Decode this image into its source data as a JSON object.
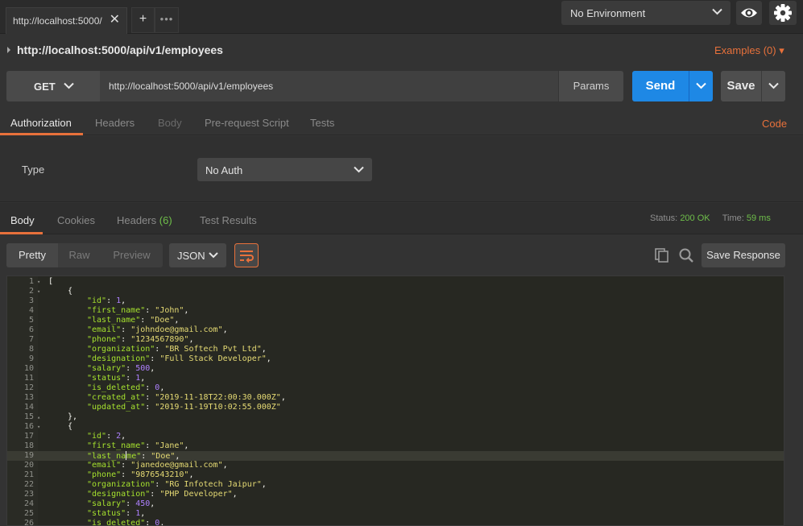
{
  "tab": {
    "title": "http://localhost:5000/",
    "close_glyph": "✕"
  },
  "new_tab_glyph": "+",
  "more_tabs_glyph": "•••",
  "environment": {
    "selected": "No Environment"
  },
  "request": {
    "title": "http://localhost:5000/api/v1/employees",
    "examples_label": "Examples (0)",
    "method": "GET",
    "url": "http://localhost:5000/api/v1/employees",
    "params_label": "Params",
    "send_label": "Send",
    "save_label": "Save"
  },
  "request_tabs": {
    "authorization": "Authorization",
    "headers": "Headers",
    "body": "Body",
    "pre_request": "Pre-request Script",
    "tests": "Tests",
    "code": "Code"
  },
  "auth": {
    "type_label": "Type",
    "selected": "No Auth"
  },
  "response_tabs": {
    "body": "Body",
    "cookies": "Cookies",
    "headers": "Headers",
    "headers_count": "(6)",
    "test_results": "Test Results"
  },
  "response_status": {
    "status_label": "Status:",
    "status_value": "200 OK",
    "time_label": "Time:",
    "time_value": "59 ms"
  },
  "response_toolbar": {
    "pretty": "Pretty",
    "raw": "Raw",
    "preview": "Preview",
    "format": "JSON",
    "save_response": "Save Response"
  },
  "colors": {
    "accent": "#e8713b",
    "send_blue": "#1e88e5",
    "ok_green": "#6fbf4a"
  },
  "icons": [
    "close-icon",
    "plus-icon",
    "more-icon",
    "chevron-down-icon",
    "eye-icon",
    "gear-icon",
    "wrap-lines-icon",
    "copy-icon",
    "search-icon"
  ],
  "code_lines": [
    {
      "n": "1",
      "fold": "▾",
      "indent": 0,
      "t": [
        [
          "p",
          "["
        ]
      ]
    },
    {
      "n": "2",
      "fold": "▾",
      "indent": 1,
      "t": [
        [
          "p",
          "{"
        ]
      ]
    },
    {
      "n": "3",
      "indent": 2,
      "t": [
        [
          "k",
          "\"id\""
        ],
        [
          "p",
          ": "
        ],
        [
          "n",
          "1"
        ],
        [
          "p",
          ","
        ]
      ]
    },
    {
      "n": "4",
      "indent": 2,
      "t": [
        [
          "k",
          "\"first_name\""
        ],
        [
          "p",
          ": "
        ],
        [
          "s",
          "\"John\""
        ],
        [
          "p",
          ","
        ]
      ]
    },
    {
      "n": "5",
      "indent": 2,
      "t": [
        [
          "k",
          "\"last_name\""
        ],
        [
          "p",
          ": "
        ],
        [
          "s",
          "\"Doe\""
        ],
        [
          "p",
          ","
        ]
      ]
    },
    {
      "n": "6",
      "indent": 2,
      "t": [
        [
          "k",
          "\"email\""
        ],
        [
          "p",
          ": "
        ],
        [
          "s",
          "\"johndoe@gmail.com\""
        ],
        [
          "p",
          ","
        ]
      ]
    },
    {
      "n": "7",
      "indent": 2,
      "t": [
        [
          "k",
          "\"phone\""
        ],
        [
          "p",
          ": "
        ],
        [
          "s",
          "\"1234567890\""
        ],
        [
          "p",
          ","
        ]
      ]
    },
    {
      "n": "8",
      "indent": 2,
      "t": [
        [
          "k",
          "\"organization\""
        ],
        [
          "p",
          ": "
        ],
        [
          "s",
          "\"BR Softech Pvt Ltd\""
        ],
        [
          "p",
          ","
        ]
      ]
    },
    {
      "n": "9",
      "indent": 2,
      "t": [
        [
          "k",
          "\"designation\""
        ],
        [
          "p",
          ": "
        ],
        [
          "s",
          "\"Full Stack Developer\""
        ],
        [
          "p",
          ","
        ]
      ]
    },
    {
      "n": "10",
      "indent": 2,
      "t": [
        [
          "k",
          "\"salary\""
        ],
        [
          "p",
          ": "
        ],
        [
          "n",
          "500"
        ],
        [
          "p",
          ","
        ]
      ]
    },
    {
      "n": "11",
      "indent": 2,
      "t": [
        [
          "k",
          "\"status\""
        ],
        [
          "p",
          ": "
        ],
        [
          "n",
          "1"
        ],
        [
          "p",
          ","
        ]
      ]
    },
    {
      "n": "12",
      "indent": 2,
      "t": [
        [
          "k",
          "\"is_deleted\""
        ],
        [
          "p",
          ": "
        ],
        [
          "n",
          "0"
        ],
        [
          "p",
          ","
        ]
      ]
    },
    {
      "n": "13",
      "indent": 2,
      "t": [
        [
          "k",
          "\"created_at\""
        ],
        [
          "p",
          ": "
        ],
        [
          "s",
          "\"2019-11-18T22:00:30.000Z\""
        ],
        [
          "p",
          ","
        ]
      ]
    },
    {
      "n": "14",
      "indent": 2,
      "t": [
        [
          "k",
          "\"updated_at\""
        ],
        [
          "p",
          ": "
        ],
        [
          "s",
          "\"2019-11-19T10:02:55.000Z\""
        ]
      ]
    },
    {
      "n": "15",
      "fold": "▴",
      "indent": 1,
      "t": [
        [
          "p",
          "},"
        ]
      ]
    },
    {
      "n": "16",
      "fold": "▾",
      "indent": 1,
      "t": [
        [
          "p",
          "{"
        ]
      ]
    },
    {
      "n": "17",
      "indent": 2,
      "t": [
        [
          "k",
          "\"id\""
        ],
        [
          "p",
          ": "
        ],
        [
          "n",
          "2"
        ],
        [
          "p",
          ","
        ]
      ]
    },
    {
      "n": "18",
      "indent": 2,
      "t": [
        [
          "k",
          "\"first_name\""
        ],
        [
          "p",
          ": "
        ],
        [
          "s",
          "\"Jane\""
        ],
        [
          "p",
          ","
        ]
      ]
    },
    {
      "n": "19",
      "indent": 2,
      "current": true,
      "t": [
        [
          "k",
          "\"last_na"
        ],
        [
          "c",
          ""
        ],
        [
          "k",
          "me\""
        ],
        [
          "p",
          ": "
        ],
        [
          "s",
          "\"Doe\""
        ],
        [
          "p",
          ","
        ]
      ]
    },
    {
      "n": "20",
      "indent": 2,
      "t": [
        [
          "k",
          "\"email\""
        ],
        [
          "p",
          ": "
        ],
        [
          "s",
          "\"janedoe@gmail.com\""
        ],
        [
          "p",
          ","
        ]
      ]
    },
    {
      "n": "21",
      "indent": 2,
      "t": [
        [
          "k",
          "\"phone\""
        ],
        [
          "p",
          ": "
        ],
        [
          "s",
          "\"9876543210\""
        ],
        [
          "p",
          ","
        ]
      ]
    },
    {
      "n": "22",
      "indent": 2,
      "t": [
        [
          "k",
          "\"organization\""
        ],
        [
          "p",
          ": "
        ],
        [
          "s",
          "\"RG Infotech Jaipur\""
        ],
        [
          "p",
          ","
        ]
      ]
    },
    {
      "n": "23",
      "indent": 2,
      "t": [
        [
          "k",
          "\"designation\""
        ],
        [
          "p",
          ": "
        ],
        [
          "s",
          "\"PHP Developer\""
        ],
        [
          "p",
          ","
        ]
      ]
    },
    {
      "n": "24",
      "indent": 2,
      "t": [
        [
          "k",
          "\"salary\""
        ],
        [
          "p",
          ": "
        ],
        [
          "n",
          "450"
        ],
        [
          "p",
          ","
        ]
      ]
    },
    {
      "n": "25",
      "indent": 2,
      "t": [
        [
          "k",
          "\"status\""
        ],
        [
          "p",
          ": "
        ],
        [
          "n",
          "1"
        ],
        [
          "p",
          ","
        ]
      ]
    },
    {
      "n": "26",
      "indent": 2,
      "t": [
        [
          "k",
          "\"is_deleted\""
        ],
        [
          "p",
          ": "
        ],
        [
          "n",
          "0"
        ],
        [
          "p",
          ","
        ]
      ]
    }
  ]
}
